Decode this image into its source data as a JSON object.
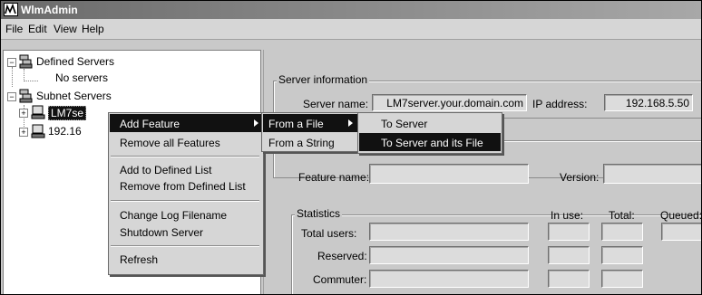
{
  "window": {
    "title": "WlmAdmin"
  },
  "menubar": [
    "File",
    "Edit",
    "View",
    "Help"
  ],
  "tree": {
    "defined_servers": "Defined Servers",
    "no_servers": "No servers",
    "subnet_servers": "Subnet Servers",
    "server1": "LM7se",
    "server2": "192.16"
  },
  "context_menu": {
    "items": [
      "Add Feature",
      "Remove all Features",
      "Add to Defined List",
      "Remove from Defined List",
      "Change Log Filename",
      "Shutdown Server",
      "Refresh"
    ]
  },
  "submenu": {
    "items": [
      "From a File",
      "From a String"
    ]
  },
  "submenu2": {
    "items": [
      "To Server",
      "To Server and its File"
    ]
  },
  "server_info": {
    "legend": "Server information",
    "server_name_label": "Server name:",
    "server_name_value": "LM7server.your.domain.com",
    "ip_label": "IP address:",
    "ip_value": "192.168.5.50"
  },
  "feature": {
    "feature_name_label": "Feature name:",
    "version_label": "Version:"
  },
  "statistics": {
    "legend": "Statistics",
    "in_use": "In use:",
    "total": "Total:",
    "queued": "Queued:",
    "total_users": "Total users:",
    "reserved": "Reserved:",
    "commuter": "Commuter:"
  },
  "colors": {
    "highlight": "#111111",
    "face": "#c9c9c9"
  }
}
